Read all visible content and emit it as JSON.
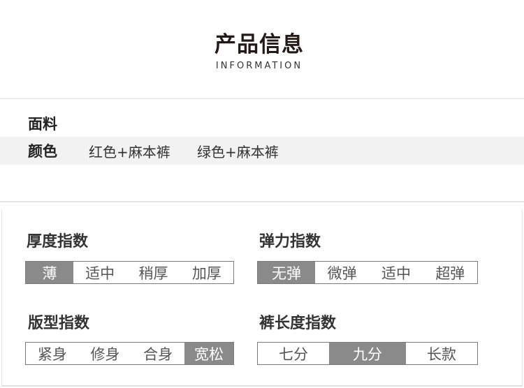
{
  "header": {
    "title": "产品信息",
    "subtitle": "INFORMATION"
  },
  "basic_info": {
    "material_label": "面料",
    "color_label": "颜色",
    "color_values": [
      "红色+麻本裤",
      "绿色+麻本裤"
    ]
  },
  "indices": [
    {
      "title": "厚度指数",
      "options": [
        "薄",
        "适中",
        "稍厚",
        "加厚"
      ],
      "selected": "薄"
    },
    {
      "title": "弹力指数",
      "options": [
        "无弹",
        "微弹",
        "适中",
        "超弹"
      ],
      "selected": "无弹"
    },
    {
      "title": "版型指数",
      "options": [
        "紧身",
        "修身",
        "合身",
        "宽松"
      ],
      "selected": "宽松"
    },
    {
      "title": "裤长度指数",
      "options": [
        "七分",
        "九分",
        "长款"
      ],
      "selected": "九分"
    }
  ],
  "colors": {
    "selected_bg": "#8a8a8a",
    "border": "#7a7a7a",
    "shaded_row": "#f2f2f2"
  }
}
